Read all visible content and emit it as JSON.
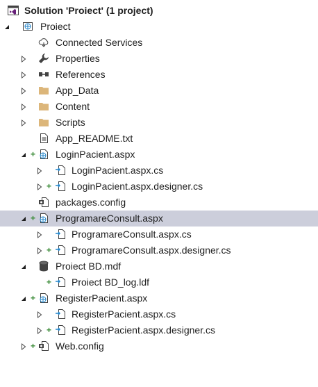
{
  "solution_explorer": {
    "colors": {
      "selection": "#cccedb",
      "vs_purple": "#68217a",
      "folder": "#dcb67a",
      "added_plus": "#388a34",
      "web_globe": "#1e82c8"
    },
    "items": [
      {
        "label": "Solution 'Proiect' (1 project)",
        "icon": "solution-icon",
        "expander": "none"
      },
      {
        "label": "Proiect",
        "icon": "web-project-icon",
        "expander": "expanded"
      },
      {
        "label": "Connected Services",
        "icon": "connected-services-icon",
        "expander": "none"
      },
      {
        "label": "Properties",
        "icon": "wrench-icon",
        "expander": "collapsed"
      },
      {
        "label": "References",
        "icon": "references-icon",
        "expander": "collapsed"
      },
      {
        "label": "App_Data",
        "icon": "folder-icon",
        "expander": "collapsed"
      },
      {
        "label": "Content",
        "icon": "folder-icon",
        "expander": "collapsed"
      },
      {
        "label": "Scripts",
        "icon": "folder-icon",
        "expander": "collapsed"
      },
      {
        "label": "App_README.txt",
        "icon": "text-file-icon",
        "expander": "none"
      },
      {
        "label": "LoginPacient.aspx",
        "icon": "aspx-page-icon",
        "expander": "expanded",
        "added": true
      },
      {
        "label": "LoginPacient.aspx.cs",
        "icon": "code-file-icon",
        "expander": "collapsed"
      },
      {
        "label": "LoginPacient.aspx.designer.cs",
        "icon": "code-file-icon",
        "expander": "collapsed",
        "added": true
      },
      {
        "label": "packages.config",
        "icon": "config-file-icon",
        "expander": "none"
      },
      {
        "label": "ProgramareConsult.aspx",
        "icon": "aspx-page-icon",
        "expander": "expanded",
        "added": true,
        "selected": true
      },
      {
        "label": "ProgramareConsult.aspx.cs",
        "icon": "code-file-icon",
        "expander": "collapsed"
      },
      {
        "label": "ProgramareConsult.aspx.designer.cs",
        "icon": "code-file-icon",
        "expander": "collapsed",
        "added": true
      },
      {
        "label": "Proiect BD.mdf",
        "icon": "database-icon",
        "expander": "expanded"
      },
      {
        "label": "Proiect BD_log.ldf",
        "icon": "code-file-icon",
        "expander": "none",
        "added": true
      },
      {
        "label": "RegisterPacient.aspx",
        "icon": "aspx-page-icon",
        "expander": "expanded",
        "added": true
      },
      {
        "label": "RegisterPacient.aspx.cs",
        "icon": "code-file-icon",
        "expander": "collapsed"
      },
      {
        "label": "RegisterPacient.aspx.designer.cs",
        "icon": "code-file-icon",
        "expander": "collapsed",
        "added": true
      },
      {
        "label": "Web.config",
        "icon": "config-file-icon",
        "expander": "collapsed",
        "added": true
      }
    ]
  }
}
